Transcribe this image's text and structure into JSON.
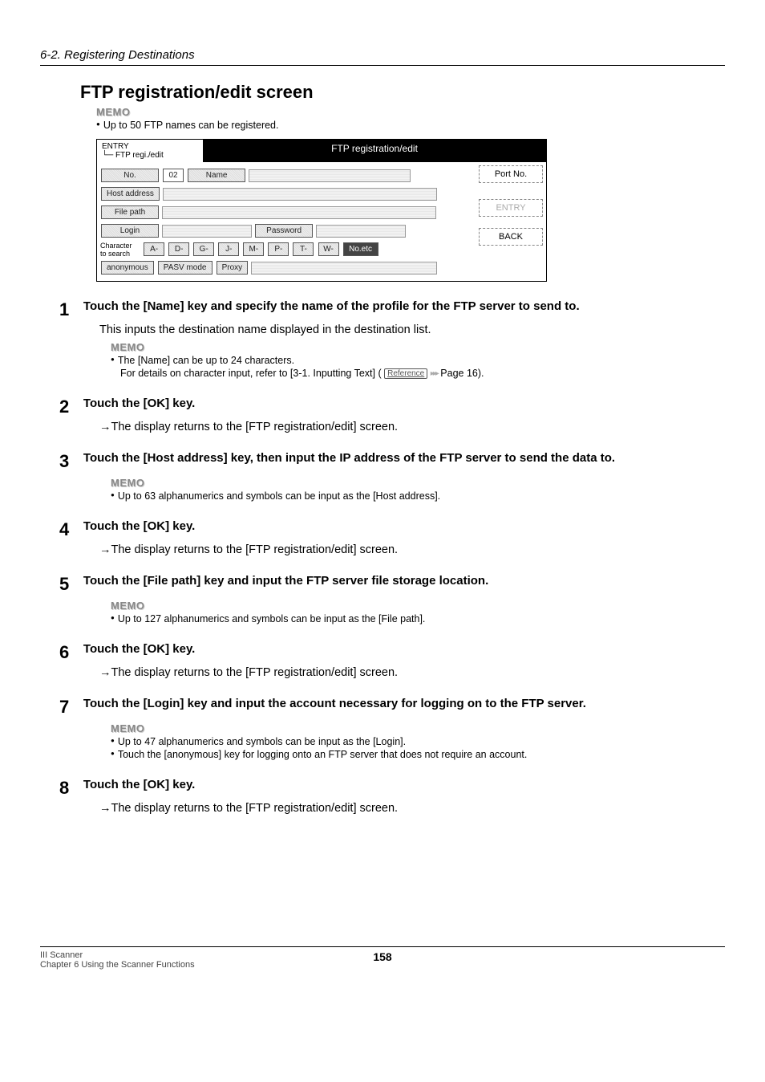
{
  "header": {
    "section": "6-2. Registering Destinations"
  },
  "title": "FTP registration/edit screen",
  "intro_memo": {
    "label": "MEMO",
    "item1": "Up to 50 FTP names can be registered."
  },
  "screenshot": {
    "entry_label": "ENTRY",
    "breadcrumb": "└─ FTP regi./edit",
    "title": "FTP registration/edit",
    "keys": {
      "no": "No.",
      "no_val": "02",
      "name": "Name",
      "host": "Host address",
      "file_path": "File path",
      "login": "Login",
      "password": "Password",
      "char_label": "Character\nto search",
      "a": "A-",
      "d": "D-",
      "g": "G-",
      "j": "J-",
      "m": "M-",
      "p": "P-",
      "t": "T-",
      "w": "W-",
      "no_etc": "No.etc",
      "anonymous": "anonymous",
      "pasv": "PASV mode",
      "proxy": "Proxy",
      "port": "Port No.",
      "entry_btn": "ENTRY",
      "back": "BACK"
    }
  },
  "steps": {
    "s1": {
      "title": "Touch the [Name] key and specify the name of the profile for the FTP server to send to.",
      "body": "This inputs the destination name displayed in the destination list.",
      "memo_label": "MEMO",
      "memo_item": "The [Name] can be up to 24 characters.",
      "memo_sub_pre": "For details on character input, refer to [3-1. Inputting Text] ( ",
      "memo_sub_ref": "Reference",
      "memo_sub_post": " Page 16)."
    },
    "s2": {
      "title": "Touch the [OK] key.",
      "body": "The display returns to the [FTP registration/edit] screen."
    },
    "s3": {
      "title": "Touch the [Host address] key, then input the IP address of the FTP server to send the data to.",
      "memo_label": "MEMO",
      "memo_item": "Up to 63 alphanumerics and symbols can be input as the [Host address]."
    },
    "s4": {
      "title": "Touch the [OK] key.",
      "body": "The display returns to the [FTP registration/edit] screen."
    },
    "s5": {
      "title": "Touch the [File path] key and input the FTP server file storage location.",
      "memo_label": "MEMO",
      "memo_item": "Up to 127 alphanumerics and symbols can be input as the [File path]."
    },
    "s6": {
      "title": "Touch the [OK] key.",
      "body": "The display returns to the [FTP registration/edit] screen."
    },
    "s7": {
      "title": "Touch the [Login] key and input the account necessary for logging on to the FTP server.",
      "memo_label": "MEMO",
      "memo_item1": "Up to 47 alphanumerics and symbols can be input as the [Login].",
      "memo_item2": "Touch the [anonymous] key for logging onto an FTP server that does not require an account."
    },
    "s8": {
      "title": "Touch the [OK] key.",
      "body": "The display returns to the [FTP registration/edit] screen."
    }
  },
  "footer": {
    "book": "III Scanner",
    "chapter": "Chapter 6 Using the Scanner Functions",
    "page": "158"
  }
}
